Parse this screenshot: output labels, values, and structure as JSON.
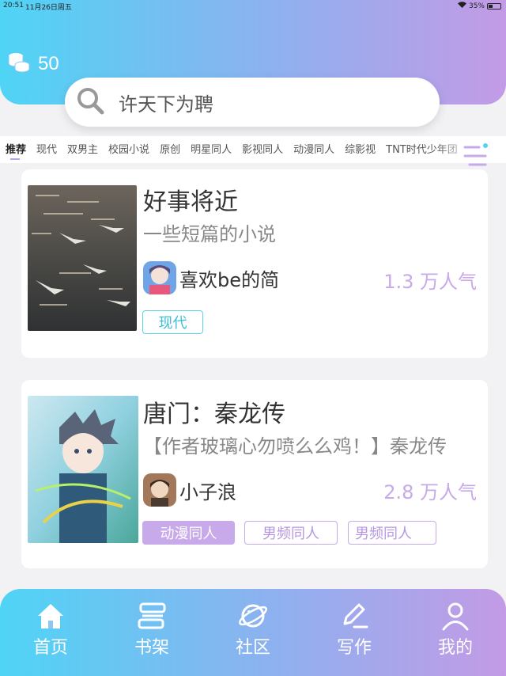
{
  "status_bar": {
    "time": "20:51",
    "date": "11月26日周五",
    "battery": "35%"
  },
  "coins": {
    "count": "50"
  },
  "search": {
    "placeholder": "许天下为聘"
  },
  "tabs": [
    "推荐",
    "现代",
    "双男主",
    "校园小说",
    "原创",
    "明星同人",
    "影视同人",
    "动漫同人",
    "综影视",
    "TNT时代少年团"
  ],
  "books": [
    {
      "title": "好事将近",
      "desc": "一些短篇的小说",
      "author": "喜欢be的简",
      "popularity": "1.3 万人气",
      "tags": [
        "现代"
      ]
    },
    {
      "title": "唐门：秦龙传",
      "desc": "【作者玻璃心勿喷么么鸡！】秦龙传",
      "author": "小子浪",
      "popularity": "2.8 万人气",
      "tags": [
        "动漫同人",
        "男频同人",
        "男频同人"
      ]
    }
  ],
  "nav": [
    {
      "label": "首页",
      "icon": "home-icon"
    },
    {
      "label": "书架",
      "icon": "bookshelf-icon"
    },
    {
      "label": "社区",
      "icon": "planet-icon"
    },
    {
      "label": "写作",
      "icon": "pen-icon"
    },
    {
      "label": "我的",
      "icon": "user-icon"
    }
  ],
  "colors": {
    "accent_cyan": "#4fd4f5",
    "accent_purple": "#c39be6",
    "tag_purple": "#c8a9ea"
  }
}
